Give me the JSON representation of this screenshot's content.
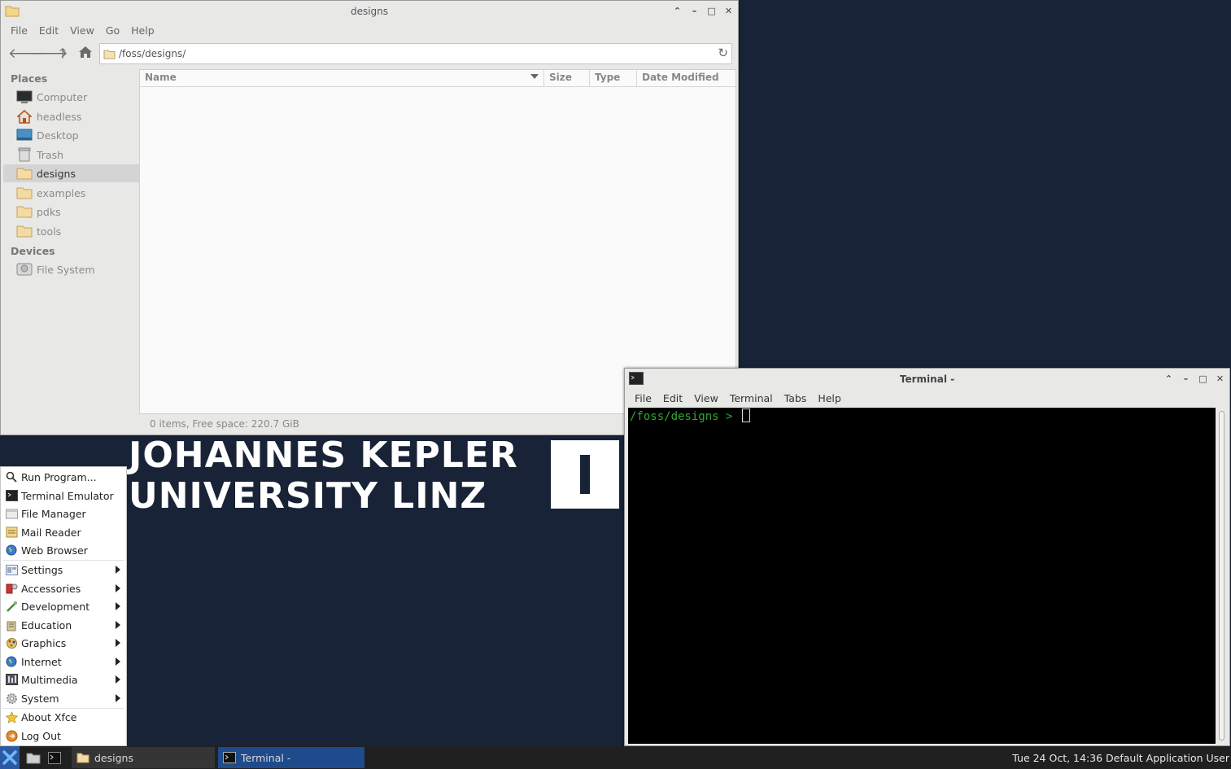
{
  "wallpaper": {
    "line1": "JOHANNES KEPLER",
    "line2": "UNIVERSITY LINZ"
  },
  "file_manager": {
    "title": "designs",
    "menu": [
      "File",
      "Edit",
      "View",
      "Go",
      "Help"
    ],
    "address": "/foss/designs/",
    "sidebar": {
      "places_heading": "Places",
      "places": [
        {
          "label": "Computer",
          "icon": "computer-icon"
        },
        {
          "label": "headless",
          "icon": "home-icon"
        },
        {
          "label": "Desktop",
          "icon": "desktop-icon"
        },
        {
          "label": "Trash",
          "icon": "trash-icon"
        },
        {
          "label": "designs",
          "icon": "folder-icon",
          "active": true
        },
        {
          "label": "examples",
          "icon": "folder-icon"
        },
        {
          "label": "pdks",
          "icon": "folder-icon"
        },
        {
          "label": "tools",
          "icon": "folder-icon"
        }
      ],
      "devices_heading": "Devices",
      "devices": [
        {
          "label": "File System",
          "icon": "drive-icon"
        }
      ]
    },
    "columns": {
      "name": "Name",
      "size": "Size",
      "type": "Type",
      "modified": "Date Modified"
    },
    "status": "0 items, Free space: 220.7 GiB"
  },
  "terminal": {
    "title": "Terminal -",
    "menu": [
      "File",
      "Edit",
      "View",
      "Terminal",
      "Tabs",
      "Help"
    ],
    "prompt": "/foss/designs > "
  },
  "app_menu": {
    "items": [
      {
        "label": "Run Program...",
        "icon": "search-icon"
      },
      {
        "label": "Terminal Emulator",
        "icon": "terminal-icon"
      },
      {
        "label": "File Manager",
        "icon": "file-manager-icon"
      },
      {
        "label": "Mail Reader",
        "icon": "mail-icon"
      },
      {
        "label": "Web Browser",
        "icon": "globe-icon"
      },
      {
        "label": "Settings",
        "icon": "settings-icon",
        "submenu": true
      },
      {
        "label": "Accessories",
        "icon": "accessories-icon",
        "submenu": true
      },
      {
        "label": "Development",
        "icon": "development-icon",
        "submenu": true
      },
      {
        "label": "Education",
        "icon": "education-icon",
        "submenu": true
      },
      {
        "label": "Graphics",
        "icon": "graphics-icon",
        "submenu": true
      },
      {
        "label": "Internet",
        "icon": "globe-icon",
        "submenu": true
      },
      {
        "label": "Multimedia",
        "icon": "multimedia-icon",
        "submenu": true
      },
      {
        "label": "System",
        "icon": "gear-icon",
        "submenu": true
      },
      {
        "label": "About Xfce",
        "icon": "star-icon"
      },
      {
        "label": "Log Out",
        "icon": "logout-icon"
      }
    ]
  },
  "taskbar": {
    "tasks": [
      {
        "label": "designs",
        "icon": "folder-icon"
      },
      {
        "label": "Terminal -",
        "icon": "terminal-icon",
        "active": true
      }
    ],
    "clock": "Tue 24 Oct, 14:36 Default Application User"
  },
  "colors": {
    "desktop": "#192337",
    "prompt": "#2fa82f",
    "active_task": "#1f4b8c"
  }
}
